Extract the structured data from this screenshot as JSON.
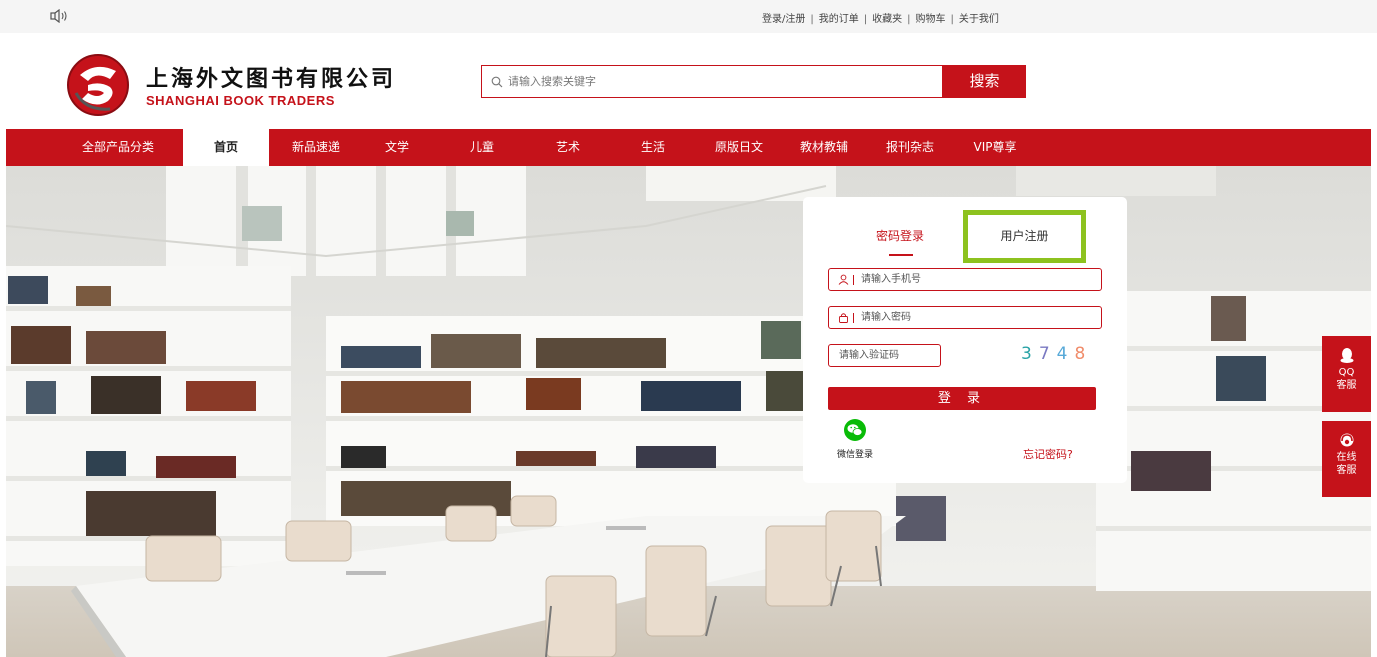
{
  "topbar": {
    "links": [
      "登录/注册",
      "我的订单",
      "收藏夹",
      "购物车",
      "关于我们"
    ],
    "separator": "|"
  },
  "logo": {
    "cn": "上海外文图书有限公司",
    "en": "Shanghai Book Traders"
  },
  "search": {
    "placeholder": "请输入搜索关键字",
    "button": "搜索"
  },
  "nav": {
    "items": [
      "全部产品分类",
      "首页",
      "新品速递",
      "文学",
      "儿童",
      "艺术",
      "生活",
      "原版日文",
      "教材教辅",
      "报刊杂志",
      "VIP尊享"
    ],
    "active_index": 1
  },
  "login": {
    "tab_password": "密码登录",
    "tab_register": "用户注册",
    "phone_placeholder": "请输入手机号",
    "password_placeholder": "请输入密码",
    "captcha_placeholder": "请输入验证码",
    "captcha_digits": [
      "3",
      "7",
      "4",
      "8"
    ],
    "captcha_colors": [
      "#2aa3a6",
      "#7a79c2",
      "#57a9d8",
      "#f08c6a"
    ],
    "login_button": "登 录",
    "wechat_label": "微信登录",
    "forgot": "忘记密码?"
  },
  "side": {
    "qq_line1": "QQ",
    "qq_line2": "客服",
    "online_line1": "在线",
    "online_line2": "客服"
  },
  "colors": {
    "brand_red": "#c5121a",
    "highlight_green": "#8dc21f"
  }
}
